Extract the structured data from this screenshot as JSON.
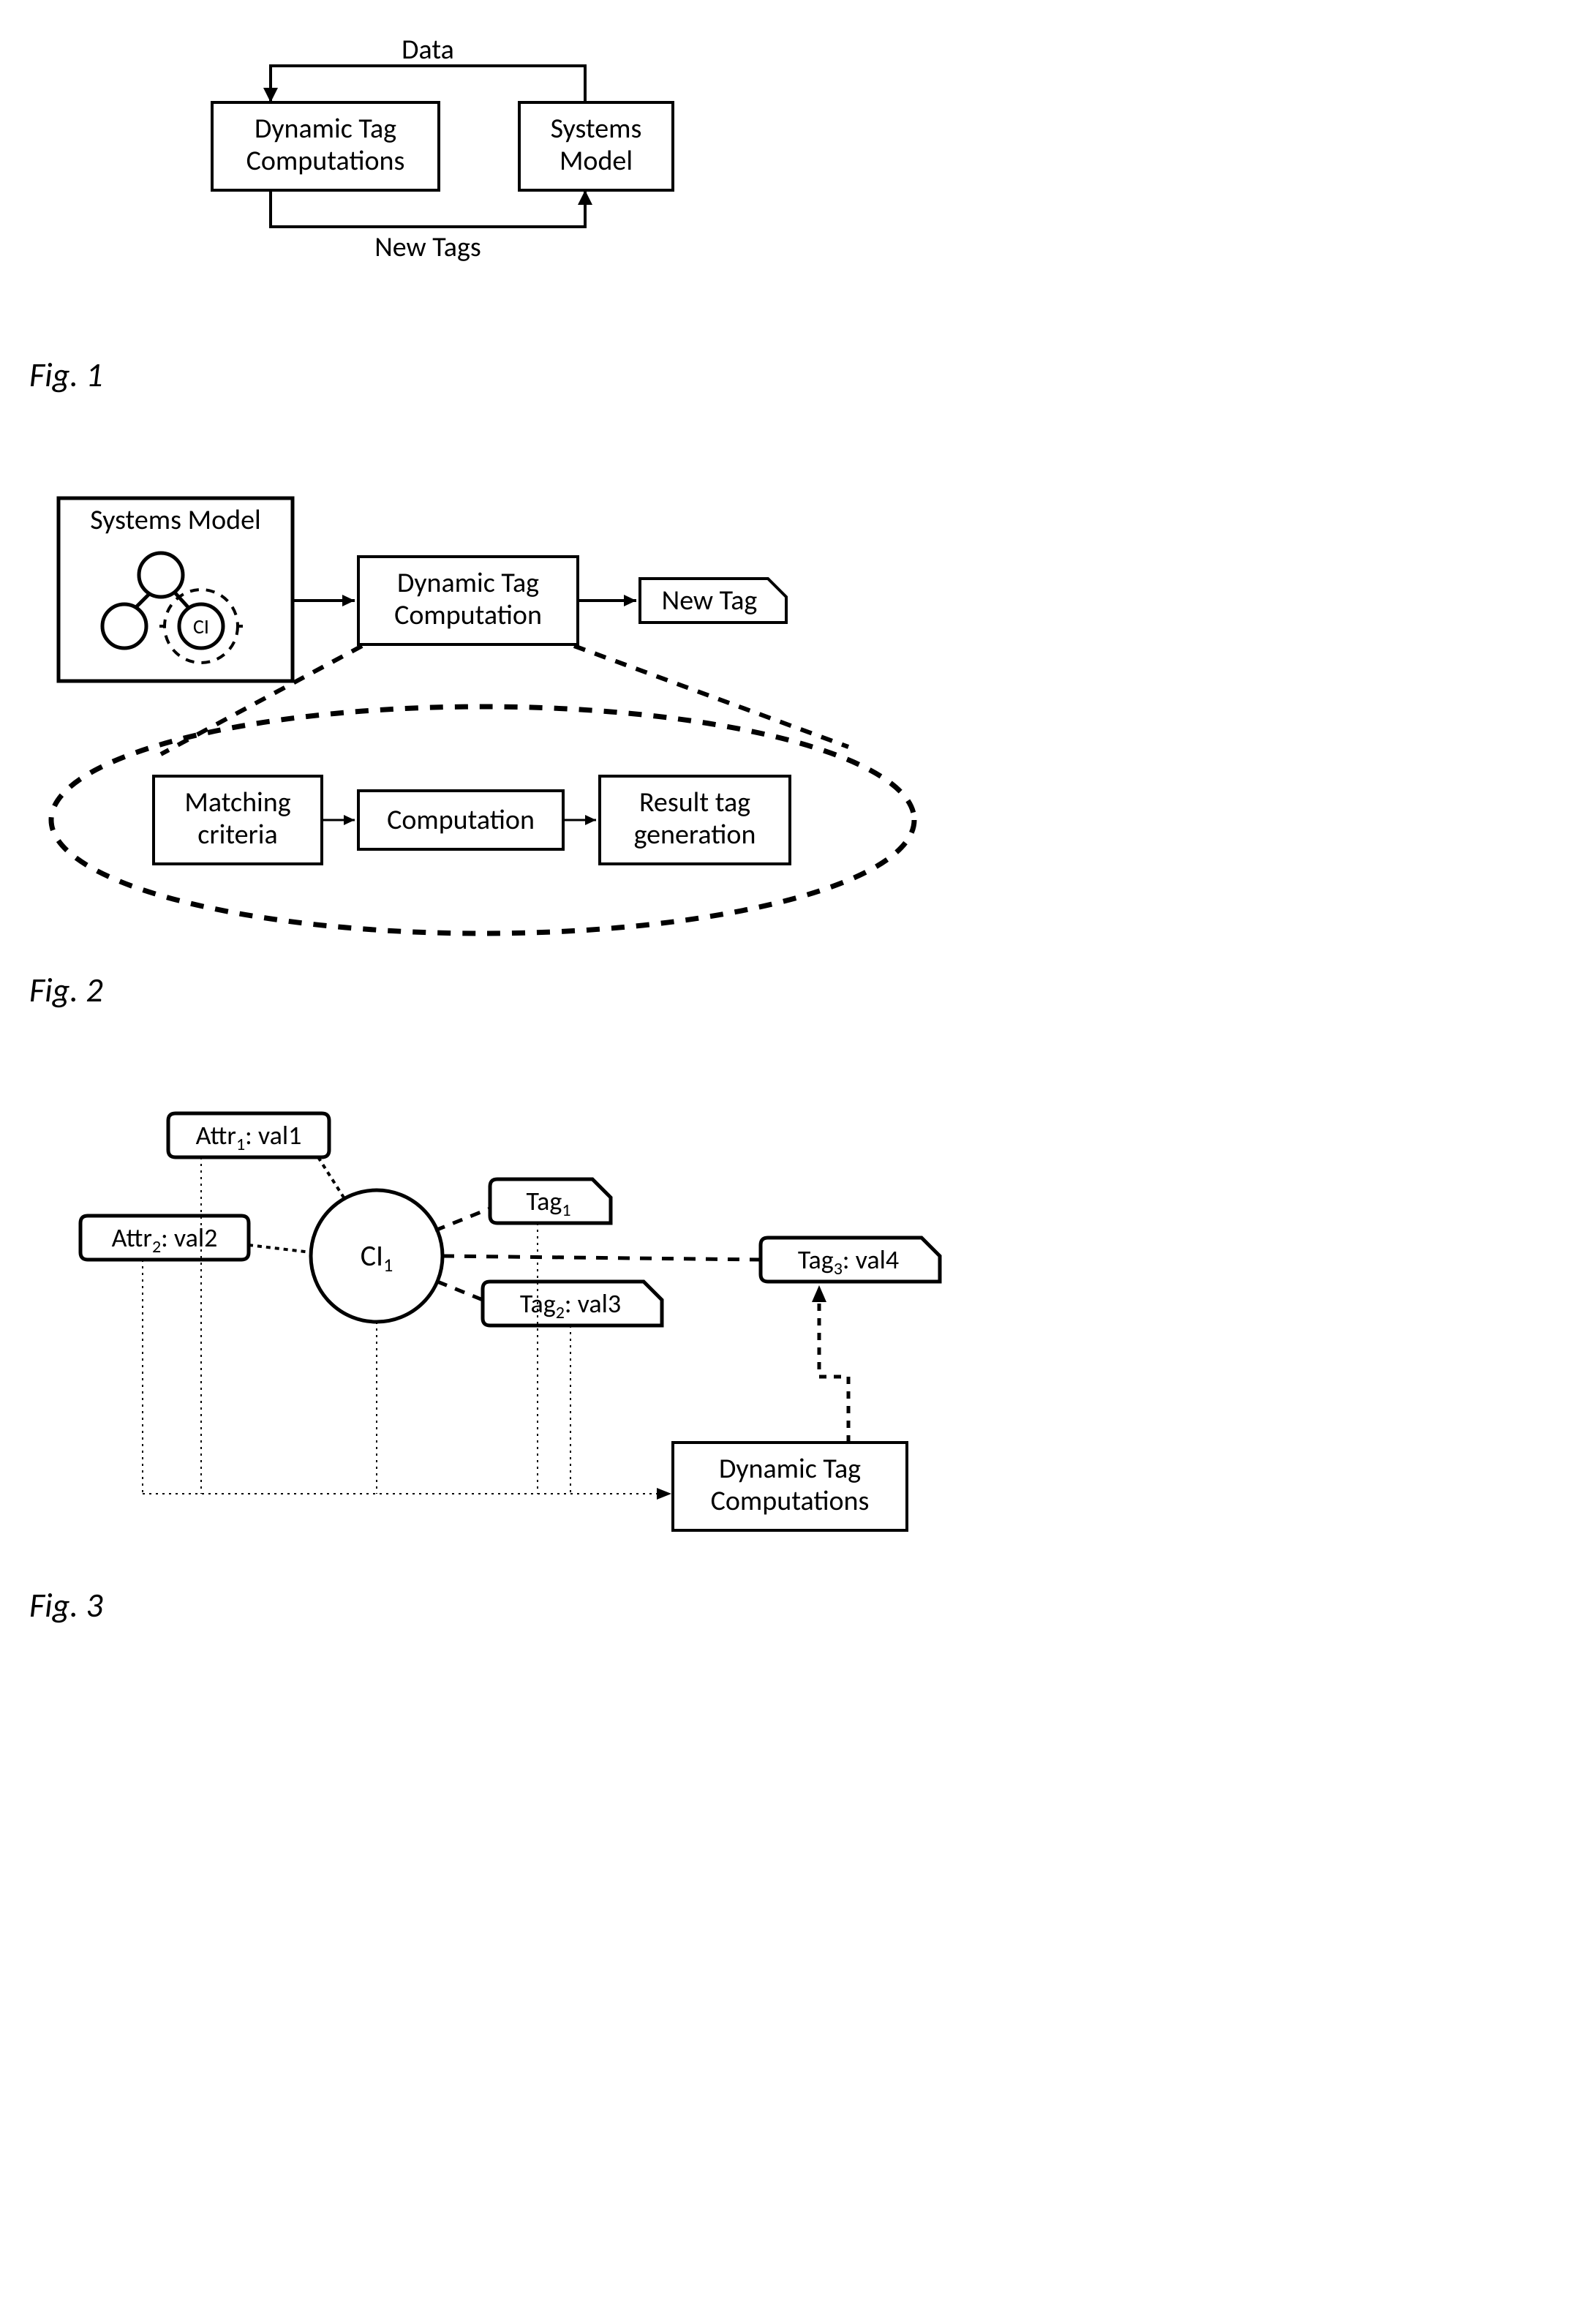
{
  "fig1": {
    "label": "Fig. 1",
    "box_left_line1": "Dynamic Tag",
    "box_left_line2": "Computations",
    "box_right_line1": "Systems",
    "box_right_line2": "Model",
    "arrow_top": "Data",
    "arrow_bottom": "New Tags"
  },
  "fig2": {
    "label": "Fig. 2",
    "sys_model": "Systems Model",
    "ci": "CI",
    "dyn_tag_line1": "Dynamic Tag",
    "dyn_tag_line2": "Computation",
    "new_tag": "New Tag",
    "sub1_line1": "Matching",
    "sub1_line2": "criteria",
    "sub2": "Computation",
    "sub3_line1": "Result tag",
    "sub3_line2": "generation"
  },
  "fig3": {
    "label": "Fig. 3",
    "attr1": "Attr",
    "attr1_sub": "1",
    "attr1_val": ": val1",
    "attr2": "Attr",
    "attr2_sub": "2",
    "attr2_val": ": val2",
    "ci": "CI",
    "ci_sub": "1",
    "tag1": "Tag",
    "tag1_sub": "1",
    "tag2": "Tag",
    "tag2_sub": "2",
    "tag2_val": ": val3",
    "tag3": "Tag",
    "tag3_sub": "3",
    "tag3_val": ": val4",
    "dyn_line1": "Dynamic Tag",
    "dyn_line2": "Computations"
  }
}
